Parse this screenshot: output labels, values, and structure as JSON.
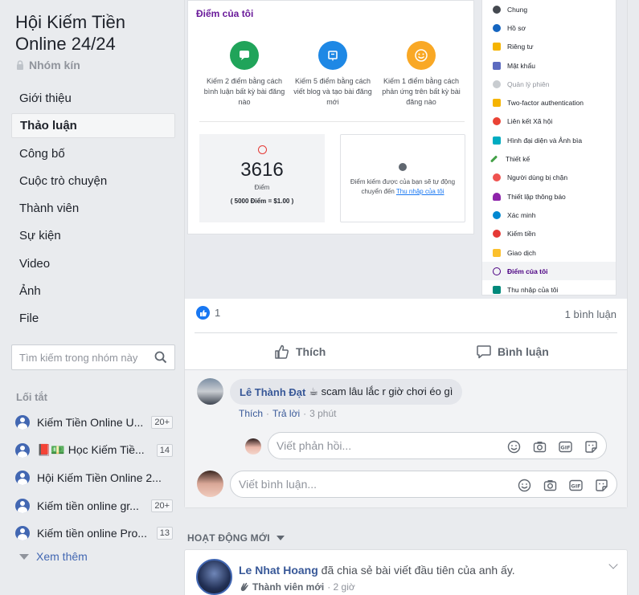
{
  "group": {
    "title": "Hội Kiếm Tiền Online 24/24",
    "privacy": "Nhóm kín"
  },
  "nav": [
    {
      "label": "Giới thiệu"
    },
    {
      "label": "Thảo luận",
      "active": true
    },
    {
      "label": "Công bố"
    },
    {
      "label": "Cuộc trò chuyện"
    },
    {
      "label": "Thành viên"
    },
    {
      "label": "Sự kiện"
    },
    {
      "label": "Video"
    },
    {
      "label": "Ảnh"
    },
    {
      "label": "File"
    }
  ],
  "sidebar_search": {
    "placeholder": "Tìm kiếm trong nhóm này"
  },
  "shortcuts": {
    "heading": "Lối tắt",
    "items": [
      {
        "label": "Kiếm Tiền Online U...",
        "badge": "20+"
      },
      {
        "label": "📕💵 Học Kiếm Tiề...",
        "badge": "14"
      },
      {
        "label": "Hội Kiếm Tiền Online 2...",
        "badge": ""
      },
      {
        "label": "Kiếm tiền online gr...",
        "badge": "20+"
      },
      {
        "label": "Kiếm tiền online Pro...",
        "badge": "13"
      }
    ],
    "see_more": "Xem thêm"
  },
  "screenshot": {
    "panel_title": "Điểm của tôi",
    "ways": [
      {
        "text": "Kiếm 2 điểm bằng cách bình luận bất kỳ bài đăng nào",
        "color": "#20a45a"
      },
      {
        "text": "Kiếm 5 điểm bằng cách viết blog và tạo bài đăng mới",
        "color": "#1e88e5"
      },
      {
        "text": "Kiếm 1 điểm bằng cách phản ứng trên bất kỳ bài đăng nào",
        "color": "#f9a825"
      }
    ],
    "score": "3616",
    "score_label": "Điểm",
    "rate": "( 5000 Điểm = $1.00 )",
    "info_text": "Điểm kiếm được của bạn sẽ tự động chuyển đến",
    "info_link": "Thu nhập của tôi",
    "menu": [
      {
        "label": "Chung",
        "color": "#444950"
      },
      {
        "label": "Hồ sơ",
        "color": "#1565c0"
      },
      {
        "label": "Riêng tư",
        "color": "#f5b400"
      },
      {
        "label": "Mật khẩu",
        "color": "#5c6bc0"
      },
      {
        "label": "Quản lý phiên",
        "color": "#c8ccd0",
        "muted": true
      },
      {
        "label": "Two-factor authentication",
        "color": "#f5b400"
      },
      {
        "label": "Liên kết Xã hội",
        "color": "#ea4335"
      },
      {
        "label": "Hình đại diện và Ảnh bìa",
        "color": "#00acc1"
      },
      {
        "label": "Thiết kế",
        "color": "#43a047"
      },
      {
        "label": "Người dùng bị chặn",
        "color": "#ef5350"
      },
      {
        "label": "Thiết lập thông báo",
        "color": "#8e24aa"
      },
      {
        "label": "Xác minh",
        "color": "#0288d1"
      },
      {
        "label": "Kiếm tiền",
        "color": "#e53935"
      },
      {
        "label": "Giao dịch",
        "color": "#fbc02d"
      },
      {
        "label": "Điểm của tôi",
        "color": "#4b0082",
        "selected": true
      },
      {
        "label": "Thu nhập của tôi",
        "color": "#00897b"
      }
    ]
  },
  "post": {
    "like_count": "1",
    "comment_count": "1 bình luận",
    "like_label": "Thích",
    "comment_label": "Bình luận"
  },
  "comment": {
    "author": "Lê Thành Đạt",
    "text": "☕ scam lâu lắc r giờ chơi éo gì",
    "like": "Thích",
    "reply": "Trả lời",
    "time": "3 phút"
  },
  "reply_input": {
    "placeholder": "Viết phản hồi..."
  },
  "comment_input": {
    "placeholder": "Viết bình luận..."
  },
  "activity": {
    "heading": "HOẠT ĐỘNG MỚI",
    "name": "Le Nhat Hoang",
    "action": "đã chia sẻ bài viết đầu tiên của anh ấy.",
    "role": "Thành viên mới",
    "time": "· 2 giờ"
  }
}
